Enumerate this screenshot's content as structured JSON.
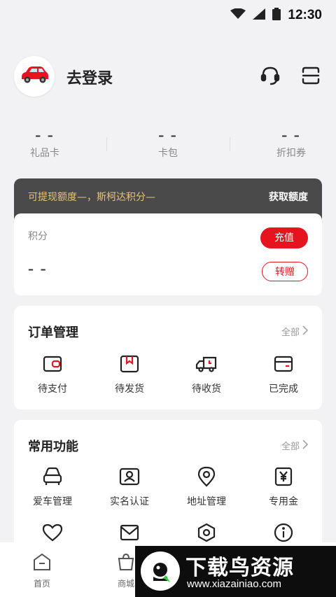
{
  "status": {
    "time": "12:30"
  },
  "profile": {
    "login_text": "去登录"
  },
  "stats": [
    {
      "value": "– –",
      "label": "礼品卡"
    },
    {
      "value": "– –",
      "label": "卡包"
    },
    {
      "value": "– –",
      "label": "折扣券"
    }
  ],
  "points": {
    "banner_text": "可提现额度—，斯柯达积分—",
    "banner_action": "获取额度",
    "label": "积分",
    "value": "– –",
    "recharge": "充值",
    "transfer": "转赠"
  },
  "orders": {
    "title": "订单管理",
    "more": "全部",
    "items": [
      {
        "label": "待支付",
        "icon": "wallet-icon"
      },
      {
        "label": "待发货",
        "icon": "package-icon"
      },
      {
        "label": "待收货",
        "icon": "truck-icon"
      },
      {
        "label": "已完成",
        "icon": "completed-icon"
      }
    ]
  },
  "functions": {
    "title": "常用功能",
    "more": "全部",
    "items": [
      {
        "label": "爱车管理",
        "icon": "car-icon"
      },
      {
        "label": "实名认证",
        "icon": "id-card-icon"
      },
      {
        "label": "地址管理",
        "icon": "location-icon"
      },
      {
        "label": "专用金",
        "icon": "yen-icon"
      }
    ],
    "row2_icons": [
      "heart-icon",
      "mail-icon",
      "settings-icon",
      "info-icon"
    ]
  },
  "tabbar": [
    {
      "label": "首页",
      "icon": "home-icon"
    },
    {
      "label": "商城",
      "icon": "shop-bag-icon"
    }
  ],
  "watermark": {
    "title": "下载鸟资源",
    "url": "www.xiazainiao.com"
  },
  "colors": {
    "accent": "#e6141e",
    "banner_bg": "#4a4a4a",
    "banner_text": "#e8c27a"
  }
}
